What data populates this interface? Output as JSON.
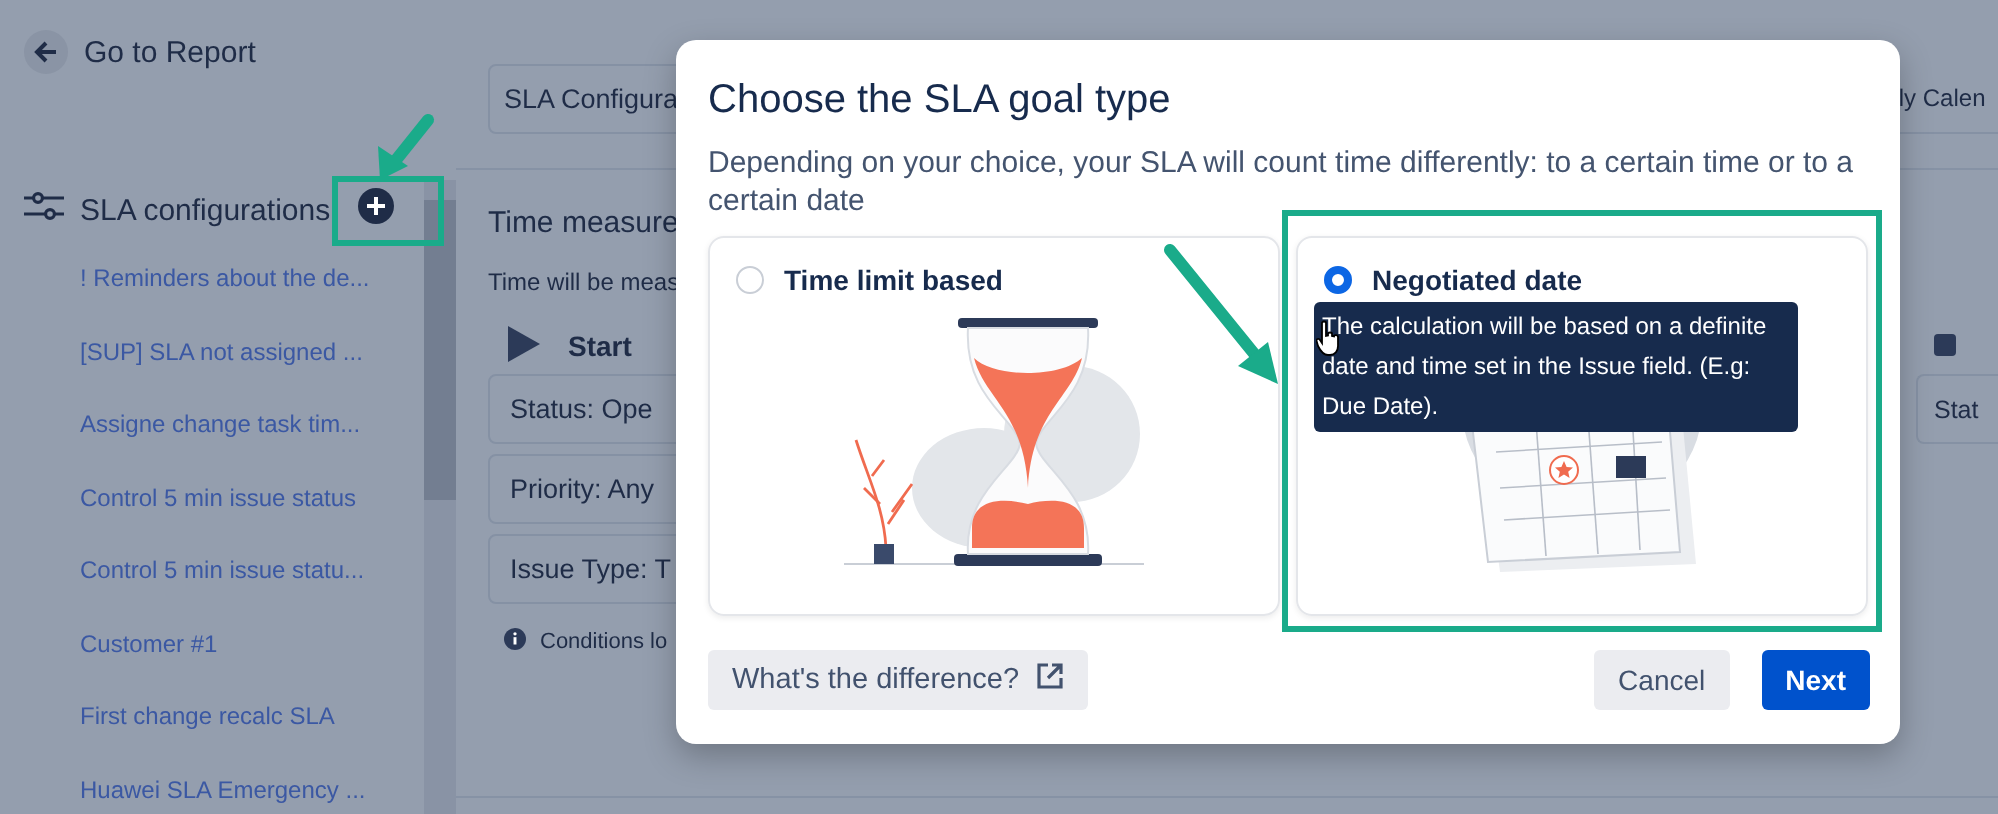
{
  "back_link": {
    "label": "Go to Report"
  },
  "sidebar": {
    "title": "SLA configurations",
    "items": [
      {
        "label": "! Reminders about the de..."
      },
      {
        "label": "[SUP] SLA not assigned ..."
      },
      {
        "label": "Assigne change task tim..."
      },
      {
        "label": "Control 5 min issue status"
      },
      {
        "label": "Control 5 min issue statu..."
      },
      {
        "label": "Customer #1"
      },
      {
        "label": "First change recalc SLA"
      },
      {
        "label": "Huawei SLA Emergency ..."
      }
    ]
  },
  "main": {
    "name_field": {
      "value": "SLA Configura"
    },
    "calendar_field": {
      "value": "ly Calen"
    },
    "section_title": "Time measure",
    "section_hint": "Time will be meas",
    "start": {
      "label": "Start",
      "conditions": [
        "Status: Ope",
        "Priority: Any",
        "Issue Type: T"
      ]
    },
    "note": "Conditions lo",
    "stop": {
      "conditions": [
        "Stat"
      ]
    }
  },
  "dialog": {
    "title": "Choose the SLA goal type",
    "description": "Depending on your choice, your SLA will count time differently: to a certain time or to a certain date",
    "options": [
      {
        "label": "Time limit based",
        "kind": "hourglass",
        "selected": false
      },
      {
        "label": "Negotiated date",
        "kind": "calendar",
        "selected": true
      }
    ],
    "tooltip": "The calculation will be based on a definite date and time set in the Issue field. (E.g: Due Date).",
    "help_link": "What's the difference?",
    "buttons": [
      {
        "label": "Cancel",
        "kind": "secondary"
      },
      {
        "label": "Next",
        "kind": "primary"
      }
    ]
  }
}
